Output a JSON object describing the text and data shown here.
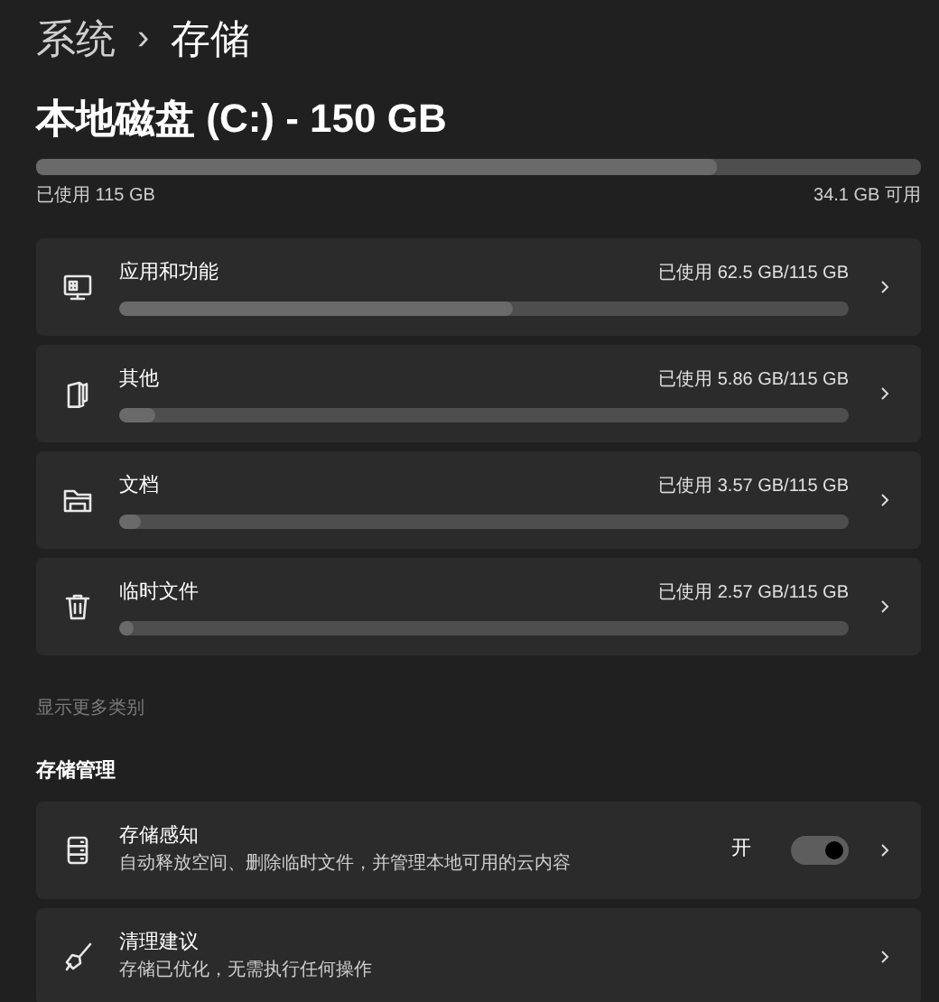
{
  "breadcrumb": {
    "parent": "系统",
    "separator": "›",
    "current": "存储"
  },
  "disk": {
    "title": "本地磁盘 (C:) - 150 GB",
    "level": 0.77,
    "used": "已使用 115 GB",
    "free": "34.1 GB 可用"
  },
  "categories": [
    {
      "name": "应用和功能",
      "usage": "已使用 62.5 GB/115 GB",
      "level": 0.54
    },
    {
      "name": "其他",
      "usage": "已使用 5.86 GB/115 GB",
      "level": 0.05
    },
    {
      "name": "文档",
      "usage": "已使用 3.57 GB/115 GB",
      "level": 0.03
    },
    {
      "name": "临时文件",
      "usage": "已使用 2.57 GB/115 GB",
      "level": 0.02
    }
  ],
  "more_link": "显示更多类别",
  "management": {
    "heading": "存储管理",
    "items": [
      {
        "kind": "toggle",
        "title": "存储感知",
        "description": "自动释放空间、删除临时文件，并管理本地可用的云内容",
        "toggle_label": "开",
        "on": true
      },
      {
        "kind": "link",
        "title": "清理建议",
        "description": "存储已优化，无需执行任何操作"
      }
    ]
  }
}
